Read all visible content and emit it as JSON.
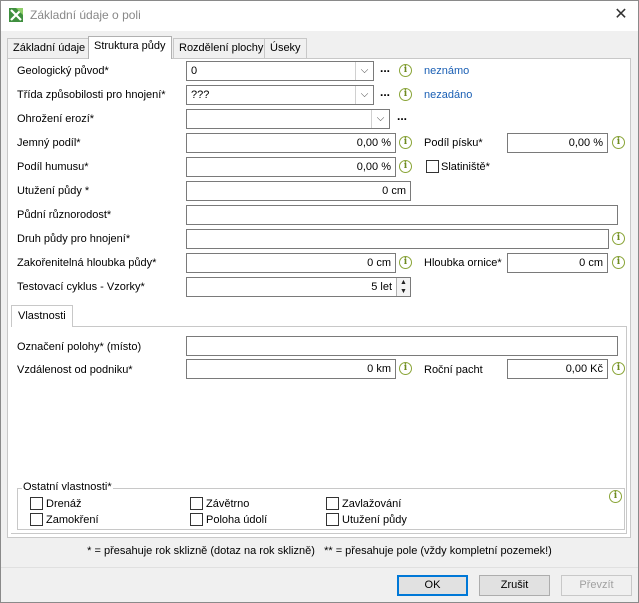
{
  "window": {
    "title": "Základní údaje o poli",
    "close_glyph": "✕"
  },
  "tabs": [
    {
      "label": "Základní údaje"
    },
    {
      "label": "Struktura půdy"
    },
    {
      "label": "Rozdělení plochy"
    },
    {
      "label": "Úseky"
    }
  ],
  "form": {
    "geologicky_puvod": {
      "label": "Geologický původ*",
      "value": "0",
      "link": "neznámo"
    },
    "trida": {
      "label": "Třída způsobilosti pro hnojení*",
      "value": "???",
      "link": "nezadáno"
    },
    "ohrozeni": {
      "label": "Ohrožení erozí*",
      "value": ""
    },
    "jemny_podil": {
      "label": "Jemný podíl*",
      "value": "0,00 %"
    },
    "podil_pisku": {
      "label": "Podíl písku*",
      "value": "0,00 %"
    },
    "podil_humusu": {
      "label": "Podíl humusu*",
      "value": "0,00 %"
    },
    "slatiniste": {
      "label": "Slatiniště*",
      "checked": false
    },
    "utuzeni": {
      "label": "Utužení půdy *",
      "value": "0 cm"
    },
    "rozmanitost": {
      "label": "Půdní různorodost*",
      "value": ""
    },
    "druh_pudy": {
      "label": "Druh půdy pro hnojení*",
      "value": ""
    },
    "zakorenitelna": {
      "label": "Zakořenitelná hloubka půdy*",
      "value": "0 cm"
    },
    "hloubka_ornice": {
      "label": "Hloubka ornice*",
      "value": "0 cm"
    },
    "testovaci": {
      "label": "Testovací cyklus - Vzorky*",
      "value": "5 let"
    },
    "dots": "...",
    "info_glyph": "i",
    "combo_arrow": "⌵"
  },
  "vlastnosti": {
    "tab_label": "Vlastnosti",
    "oznaceni": {
      "label": "Označení polohy* (místo)",
      "value": ""
    },
    "vzdalenost": {
      "label": "Vzdálenost od podniku*",
      "value": "0 km"
    },
    "rocni_pacht": {
      "label": "Roční pacht",
      "value": "0,00 Kč"
    },
    "ostatni_label": "Ostatní vlastnosti*",
    "checkboxes": [
      {
        "label": "Drenáž",
        "checked": false
      },
      {
        "label": "Zamokření",
        "checked": false
      },
      {
        "label": "Závětrno",
        "checked": false
      },
      {
        "label": "Poloha údolí",
        "checked": false
      },
      {
        "label": "Zavlažování",
        "checked": false
      },
      {
        "label": "Utužení půdy",
        "checked": false
      }
    ]
  },
  "footnote": "* = přesahuje rok sklizně (dotaz na rok sklizně)   ** = přesahuje pole (vždy kompletní pozemek!)",
  "buttons": {
    "ok": "OK",
    "zrusit": "Zrušit",
    "prevzit": "Převzít"
  },
  "colors": {
    "accent": "#0078d7",
    "link": "#1a5fb4",
    "info_icon": "#6d8a1f"
  }
}
